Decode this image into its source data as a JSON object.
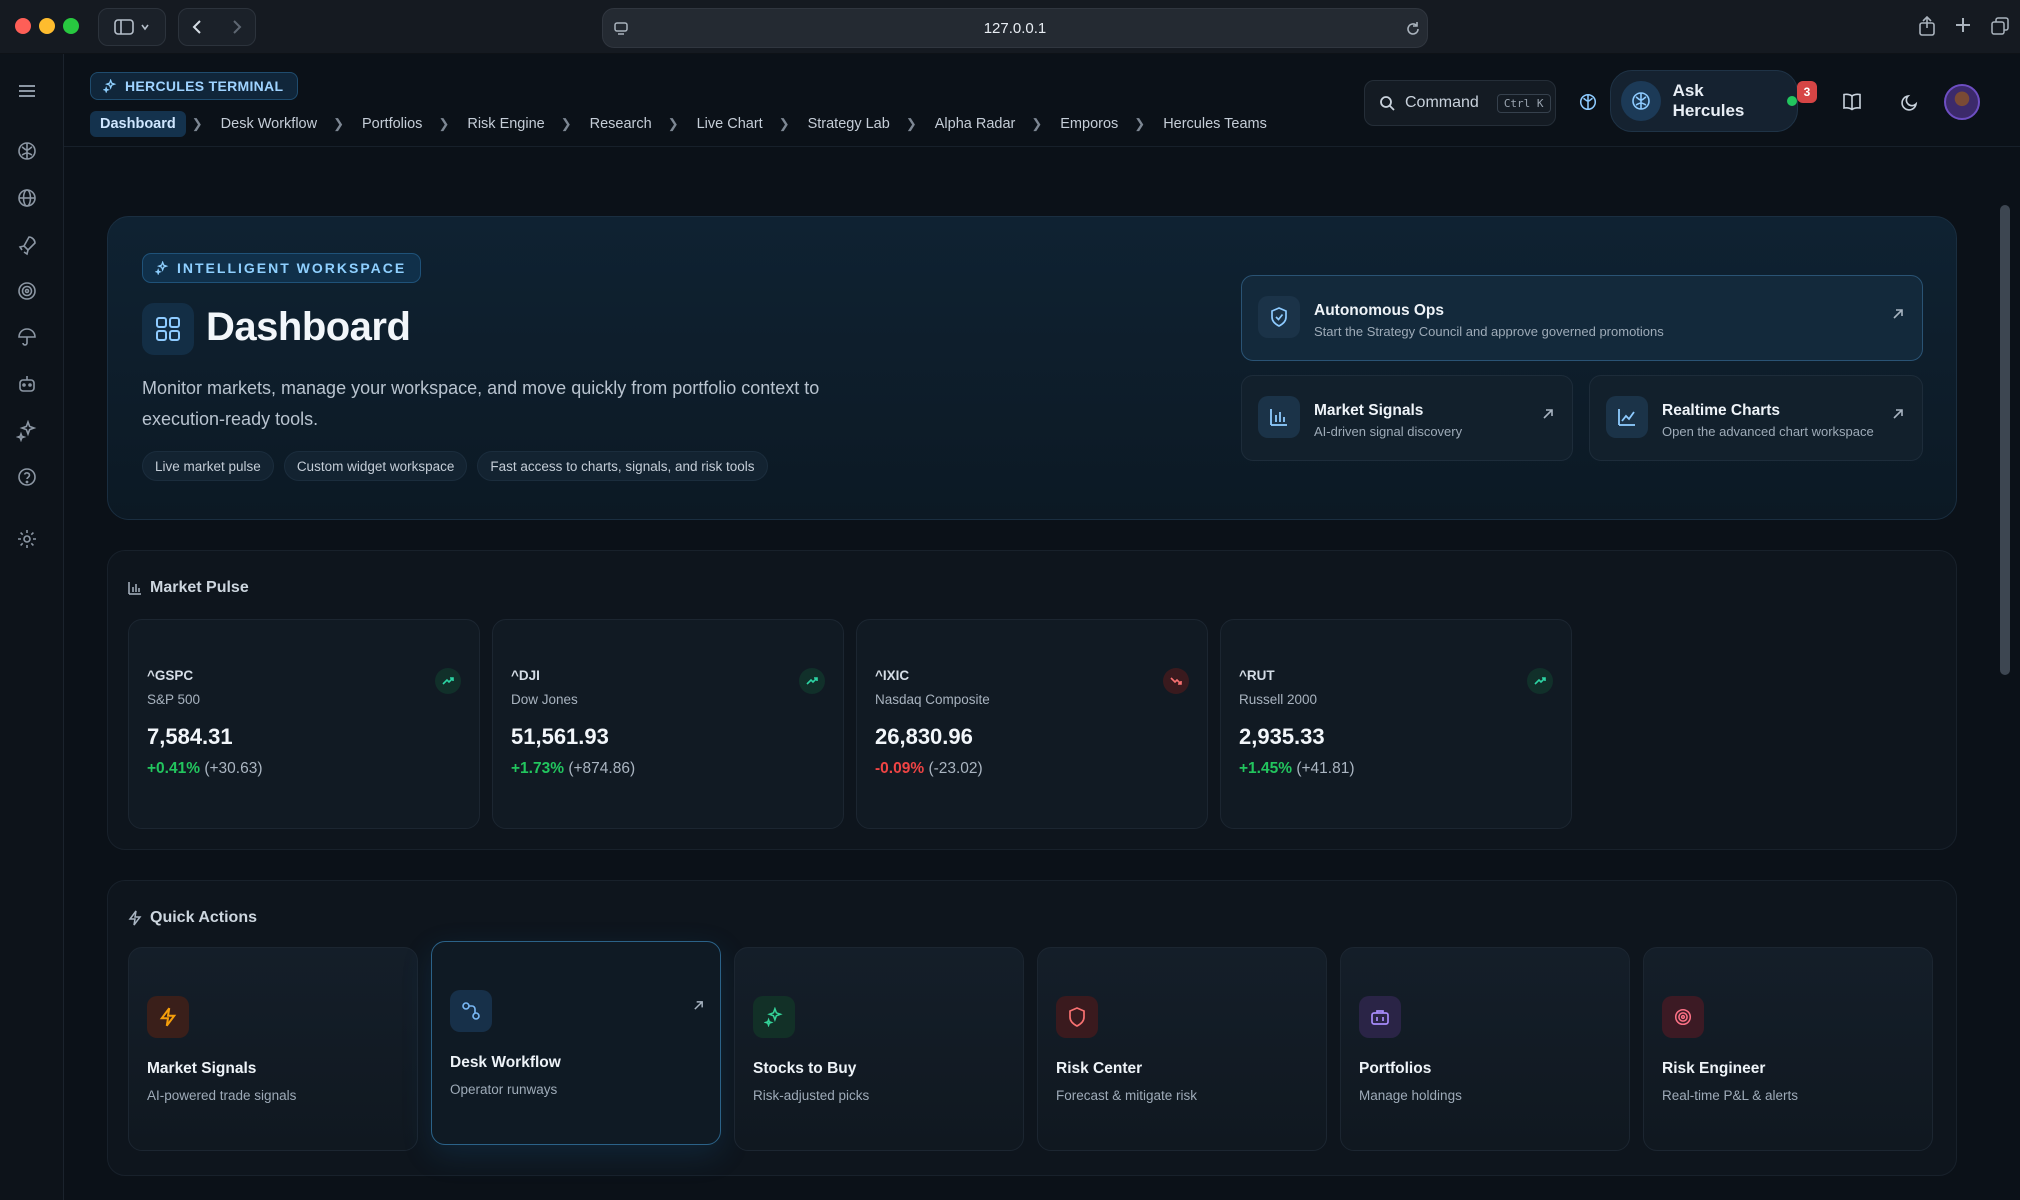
{
  "browser": {
    "url": "127.0.0.1"
  },
  "app": {
    "brand": "HERCULES TERMINAL",
    "breadcrumbs": [
      {
        "label": "Dashboard",
        "active": true
      },
      {
        "label": "Desk Workflow"
      },
      {
        "label": "Portfolios"
      },
      {
        "label": "Risk Engine"
      },
      {
        "label": "Research"
      },
      {
        "label": "Live Chart"
      },
      {
        "label": "Strategy Lab"
      },
      {
        "label": "Alpha Radar"
      },
      {
        "label": "Emporos"
      },
      {
        "label": "Hercules Teams"
      }
    ],
    "command": {
      "label": "Command",
      "shortcut": "Ctrl K"
    },
    "ask": {
      "label": "Ask Hercules",
      "status_color": "#22c55e"
    },
    "notifications": "3"
  },
  "hero": {
    "badge": "INTELLIGENT WORKSPACE",
    "title": "Dashboard",
    "description": "Monitor markets, manage your workspace, and move quickly from portfolio context to execution-ready tools.",
    "chips": [
      "Live market pulse",
      "Custom widget workspace",
      "Fast access to charts, signals, and risk tools"
    ],
    "cards": [
      {
        "title": "Autonomous Ops",
        "subtitle": "Start the Strategy Council and approve governed promotions",
        "icon": "shield-icon"
      },
      {
        "title": "Market Signals",
        "subtitle": "AI-driven signal discovery",
        "icon": "bar-chart-icon"
      },
      {
        "title": "Realtime Charts",
        "subtitle": "Open the advanced chart workspace",
        "icon": "line-chart-icon"
      }
    ]
  },
  "market_pulse": {
    "title": "Market Pulse",
    "tickers": [
      {
        "symbol": "^GSPC",
        "name": "S&P 500",
        "price": "7,584.31",
        "pct": "+0.41%",
        "change": "(+30.63)",
        "direction": "up"
      },
      {
        "symbol": "^DJI",
        "name": "Dow Jones",
        "price": "51,561.93",
        "pct": "+1.73%",
        "change": "(+874.86)",
        "direction": "up"
      },
      {
        "symbol": "^IXIC",
        "name": "Nasdaq Composite",
        "price": "26,830.96",
        "pct": "-0.09%",
        "change": "(-23.02)",
        "direction": "down"
      },
      {
        "symbol": "^RUT",
        "name": "Russell 2000",
        "price": "2,935.33",
        "pct": "+1.45%",
        "change": "(+41.81)",
        "direction": "up"
      }
    ]
  },
  "quick_actions": {
    "title": "Quick Actions",
    "items": [
      {
        "title": "Market Signals",
        "subtitle": "AI-powered trade signals",
        "icon": "lightning-icon",
        "color": "#f59e0b"
      },
      {
        "title": "Desk Workflow",
        "subtitle": "Operator runways",
        "icon": "workflow-icon",
        "color": "#60a5fa",
        "selected": true
      },
      {
        "title": "Stocks to Buy",
        "subtitle": "Risk-adjusted picks",
        "icon": "sparkle-icon",
        "color": "#34d399"
      },
      {
        "title": "Risk Center",
        "subtitle": "Forecast & mitigate risk",
        "icon": "shield-icon",
        "color": "#f87171"
      },
      {
        "title": "Portfolios",
        "subtitle": "Manage holdings",
        "icon": "briefcase-icon",
        "color": "#a78bfa"
      },
      {
        "title": "Risk Engineer",
        "subtitle": "Real-time P&L & alerts",
        "icon": "target-icon",
        "color": "#fb7185"
      }
    ]
  }
}
